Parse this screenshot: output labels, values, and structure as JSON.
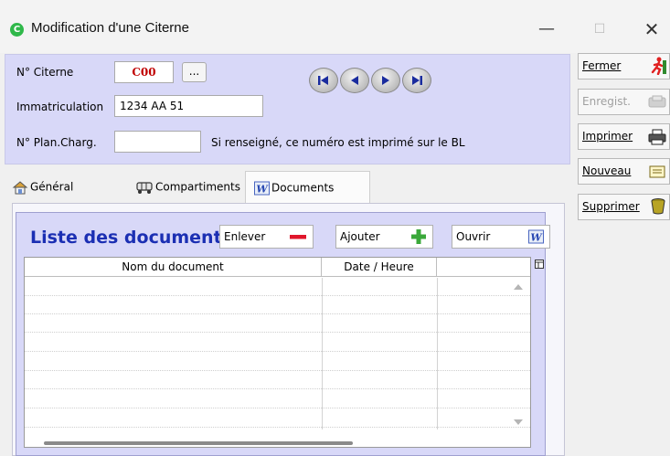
{
  "window": {
    "title": "Modification d'une Citerne",
    "minimize_glyph": "—",
    "maximize_glyph": "☐",
    "close_glyph": "✕"
  },
  "header": {
    "citerne_label": "N° Citerne",
    "citerne_value": "C00",
    "ellipsis_label": "...",
    "immat_label": "Immatriculation",
    "immat_value": "1234 AA 51",
    "plan_label": "N° Plan.Charg.",
    "plan_value": "",
    "plan_hint": "Si renseigné, ce numéro est imprimé sur le BL",
    "nav_icons": [
      "first-record-icon",
      "previous-record-icon",
      "next-record-icon",
      "last-record-icon"
    ]
  },
  "tabs": [
    {
      "label": "Général",
      "icon": "house-icon"
    },
    {
      "label": "Compartiments",
      "icon": "compartments-icon"
    },
    {
      "label": "Documents",
      "icon": "word-document-icon",
      "active": true
    }
  ],
  "documents": {
    "title": "Liste des documents",
    "remove_label": "Enlever",
    "add_label": "Ajouter",
    "open_label": "Ouvrir",
    "columns": [
      "Nom du document",
      "Date / Heure"
    ],
    "rows": []
  },
  "side_buttons": [
    {
      "label": "Fermer",
      "icon": "exit-running-man-icon",
      "enabled": true
    },
    {
      "label": "Enregist.",
      "icon": "save-icon",
      "enabled": false
    },
    {
      "label": "Imprimer",
      "icon": "printer-icon",
      "enabled": true
    },
    {
      "label": "Nouveau",
      "icon": "new-document-icon",
      "enabled": true
    },
    {
      "label": "Supprimer",
      "icon": "trash-bin-icon",
      "enabled": true
    }
  ],
  "colors": {
    "panel": "#d8d8f8",
    "title_blue": "#1b2fb3",
    "number_red": "#c00000",
    "app_icon_green": "#2fb84a"
  }
}
